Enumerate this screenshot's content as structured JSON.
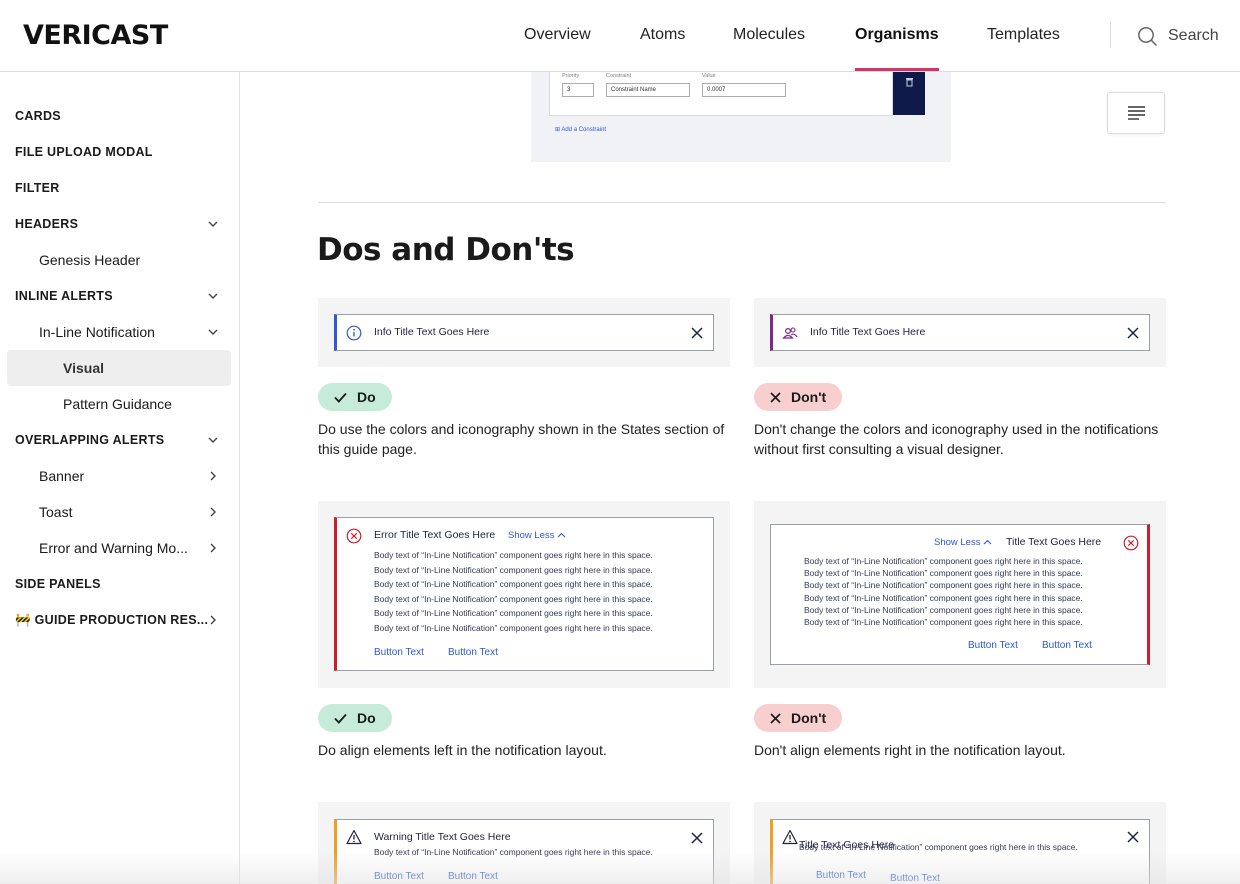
{
  "header": {
    "logo": "VERICAST",
    "nav": [
      "Overview",
      "Atoms",
      "Molecules",
      "Organisms",
      "Templates"
    ],
    "active_nav": "Organisms",
    "search_label": "Search",
    "accent": "#d6336c"
  },
  "sidebar": {
    "items": [
      {
        "label": "CARDS",
        "level": "sec"
      },
      {
        "label": "FILE UPLOAD MODAL",
        "level": "sec"
      },
      {
        "label": "FILTER",
        "level": "sec"
      },
      {
        "label": "HEADERS",
        "level": "sec",
        "chevron": "down"
      },
      {
        "label": "Genesis Header",
        "level": "l1"
      },
      {
        "label": "INLINE ALERTS",
        "level": "sec",
        "chevron": "down"
      },
      {
        "label": "In-Line Notification",
        "level": "l1",
        "chevron": "down"
      },
      {
        "label": "Visual",
        "level": "l2",
        "selected": true
      },
      {
        "label": "Pattern Guidance",
        "level": "l2"
      },
      {
        "label": "OVERLAPPING ALERTS",
        "level": "sec",
        "chevron": "down"
      },
      {
        "label": "Banner",
        "level": "l1",
        "chevron": "right"
      },
      {
        "label": "Toast",
        "level": "l1",
        "chevron": "right"
      },
      {
        "label": "Error and Warning Mo...",
        "level": "l1",
        "chevron": "right"
      },
      {
        "label": "SIDE PANELS",
        "level": "sec"
      },
      {
        "label": "🚧 GUIDE PRODUCTION RES...",
        "level": "sec",
        "chevron": "right"
      }
    ]
  },
  "top_image": {
    "priority_label": "Priority",
    "priority_value": "3",
    "constraint_label": "Constraint",
    "constraint_value": "Constraint Name",
    "value_label": "Value",
    "value_value": "0.0007",
    "add_link": "Add a Constraint"
  },
  "section": {
    "title": "Dos and Don'ts"
  },
  "examples": {
    "info_title": "Info Title Text Goes Here",
    "error_title": "Error Title Text Goes Here",
    "warning_title": "Warning Title Text Goes Here",
    "plain_title": "Title Text Goes Here",
    "show_less": "Show Less",
    "body_line": "Body text of “In-Line Notification” component goes right here in this space.",
    "button_text": "Button Text"
  },
  "badges": {
    "do": "Do",
    "dont": "Don't"
  },
  "rows": [
    {
      "do_text": "Do use the colors and iconography shown in the States section of this guide page.",
      "dont_text": "Don't change the colors and iconography used in the notifications without first consulting a visual designer."
    },
    {
      "do_text": "Do align elements left in the notification layout.",
      "dont_text": "Don't align elements right in the notification layout."
    }
  ],
  "colors": {
    "info_blue": "#3358d4",
    "purple": "#7b2a8c",
    "error_red": "#c8202f",
    "warning_orange": "#f0a020",
    "link_blue": "#2c58d6",
    "do_green": "#c6ecd9",
    "dont_red": "#f8cfcf"
  }
}
